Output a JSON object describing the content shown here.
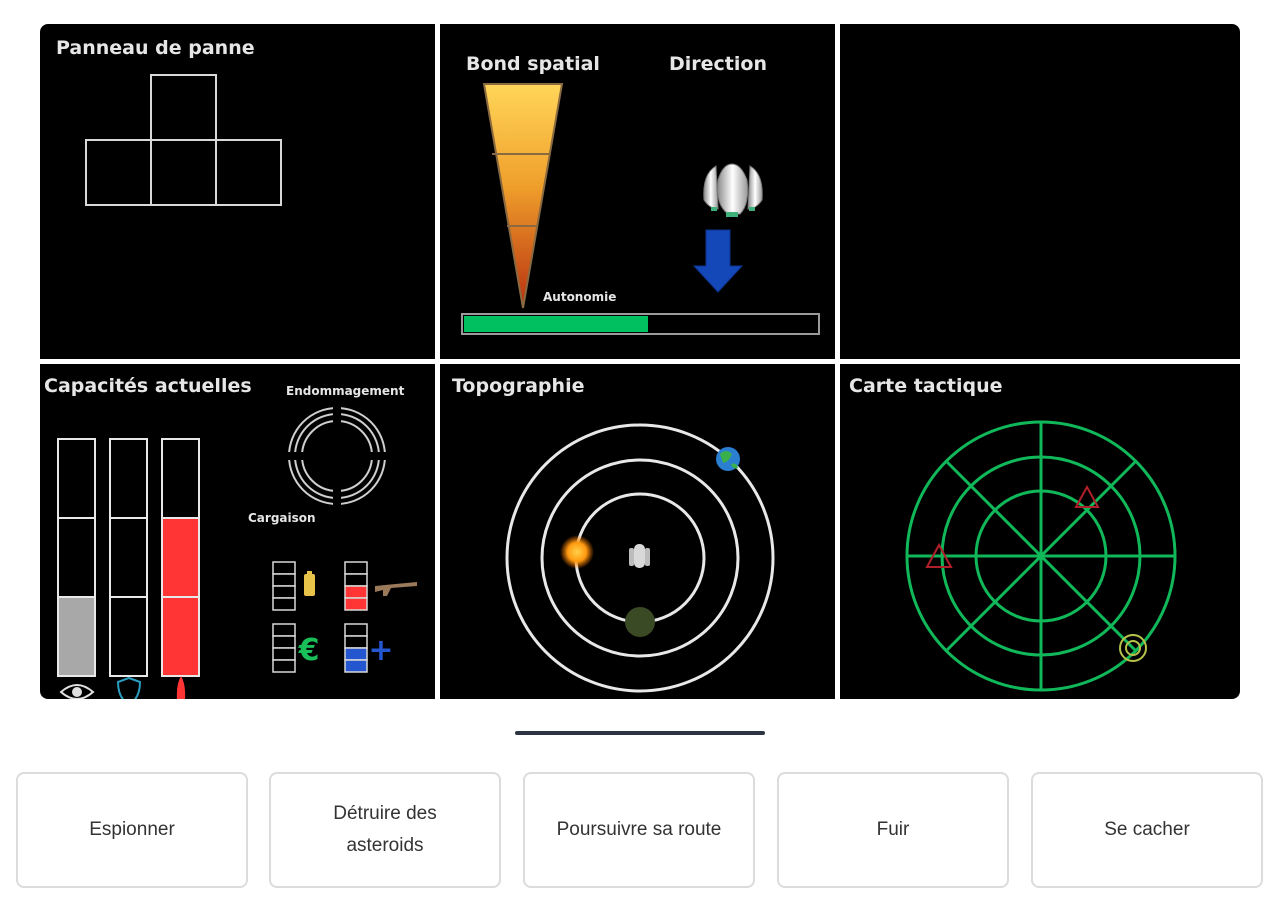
{
  "panels": {
    "breakdown": {
      "title": "Panneau de panne"
    },
    "jump": {
      "bond_label": "Bond spatial",
      "direction_label": "Direction",
      "autonomy_label": "Autonomie",
      "autonomy_fraction": 0.52,
      "autonomy_color": "#00c060"
    },
    "capacities": {
      "title": "Capacités actuelles",
      "damage_label": "Endommagement",
      "cargo_label": "Cargaison",
      "bars": [
        {
          "name": "vision",
          "icon": "eye-icon",
          "level": 1,
          "max": 3,
          "color": "#a8a8a8"
        },
        {
          "name": "shield",
          "icon": "shield-icon",
          "level": 0,
          "max": 3,
          "color": "#2a9cc0"
        },
        {
          "name": "rocket",
          "icon": "rocket-icon",
          "level": 2,
          "max": 3,
          "color": "#ff3535"
        }
      ],
      "cargo": [
        {
          "icon": "battery-icon",
          "level": 0,
          "max": 4,
          "color": "#e8c34a"
        },
        {
          "icon": "rifle-icon",
          "level": 2,
          "max": 4,
          "color": "#ff3535"
        },
        {
          "icon": "euro-icon",
          "label": "€",
          "level": 0,
          "max": 4,
          "color": "#19c05a"
        },
        {
          "icon": "plus-icon",
          "label": "+",
          "level": 2,
          "max": 4,
          "color": "#2456d0"
        }
      ]
    },
    "topography": {
      "title": "Topographie"
    },
    "tactical": {
      "title": "Carte tactique",
      "color": "#11b85a",
      "enemy_color": "#b0202a"
    }
  },
  "actions": [
    {
      "label": "Espionner"
    },
    {
      "label": "Détruire des asteroids"
    },
    {
      "label": "Poursuivre sa route"
    },
    {
      "label": "Fuir"
    },
    {
      "label": "Se cacher"
    }
  ]
}
